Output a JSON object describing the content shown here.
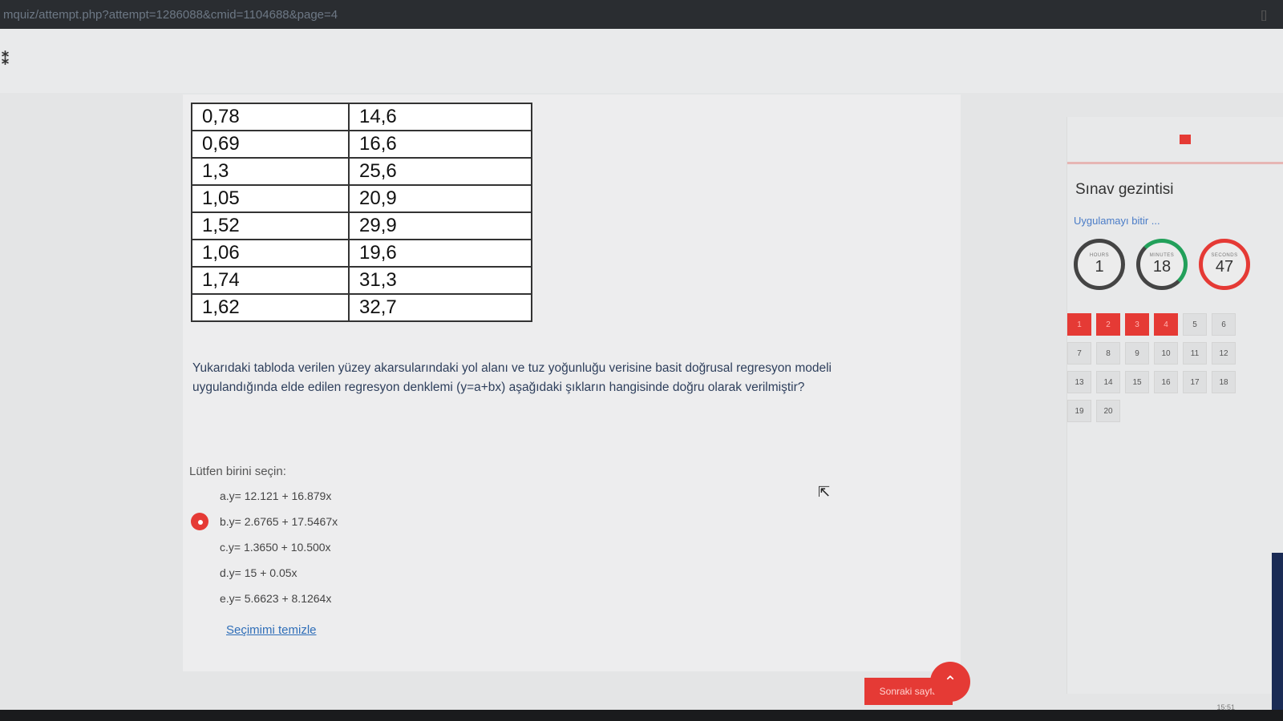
{
  "url_bar": {
    "text": "mquiz/attempt.php?attempt=1286088&cmid=1104688&page=4",
    "window_button": "[]"
  },
  "table": {
    "rows": [
      [
        "0,78",
        "14,6"
      ],
      [
        "0,69",
        "16,6"
      ],
      [
        "1,3",
        "25,6"
      ],
      [
        "1,05",
        "20,9"
      ],
      [
        "1,52",
        "29,9"
      ],
      [
        "1,06",
        "19,6"
      ],
      [
        "1,74",
        "31,3"
      ],
      [
        "1,62",
        "32,7"
      ]
    ]
  },
  "question": {
    "text": "Yukarıdaki tabloda verilen yüzey akarsularındaki yol alanı ve tuz yoğunluğu verisine basit doğrusal regresyon modeli uygulandığında elde edilen regresyon denklemi (y=a+bx) aşağıdaki şıkların hangisinde doğru olarak verilmiştir?",
    "prompt": "Lütfen birini seçin:",
    "answers": [
      {
        "label": "a.y= 12.121 + 16.879x",
        "checked": false
      },
      {
        "label": "b.y= 2.6765 + 17.5467x",
        "checked": true
      },
      {
        "label": "c.y= 1.3650 + 10.500x",
        "checked": false
      },
      {
        "label": "d.y= 15 + 0.05x",
        "checked": false
      },
      {
        "label": "e.y= 5.6623 + 8.1264x",
        "checked": false
      }
    ],
    "clear_label": "Seçimimi temizle"
  },
  "footer": {
    "next_label": "Sonraki sayfa",
    "fab_icon": "chevron-up-icon"
  },
  "sidebar": {
    "title": "Sınav gezintisi",
    "finish_link": "Uygulamayı bitir ...",
    "timers": {
      "hours": {
        "label": "HOURS",
        "value": "1"
      },
      "minutes": {
        "label": "MINUTES",
        "value": "18"
      },
      "seconds": {
        "label": "SECONDS",
        "value": "47"
      }
    },
    "questions": [
      {
        "n": "1",
        "answered": true
      },
      {
        "n": "2",
        "answered": true
      },
      {
        "n": "3",
        "answered": true
      },
      {
        "n": "4",
        "answered": true
      },
      {
        "n": "5",
        "answered": false
      },
      {
        "n": "6",
        "answered": false
      },
      {
        "n": "7",
        "answered": false
      },
      {
        "n": "8",
        "answered": false
      },
      {
        "n": "9",
        "answered": false
      },
      {
        "n": "10",
        "answered": false
      },
      {
        "n": "11",
        "answered": false
      },
      {
        "n": "12",
        "answered": false
      },
      {
        "n": "13",
        "answered": false
      },
      {
        "n": "14",
        "answered": false
      },
      {
        "n": "15",
        "answered": false
      },
      {
        "n": "16",
        "answered": false
      },
      {
        "n": "17",
        "answered": false
      },
      {
        "n": "18",
        "answered": false
      },
      {
        "n": "19",
        "answered": false
      },
      {
        "n": "20",
        "answered": false
      }
    ]
  },
  "taskbar": {
    "time": "15:51"
  },
  "colors": {
    "accent": "#e53a35",
    "link": "#2f6eb8",
    "timer_green": "#22a05a"
  }
}
